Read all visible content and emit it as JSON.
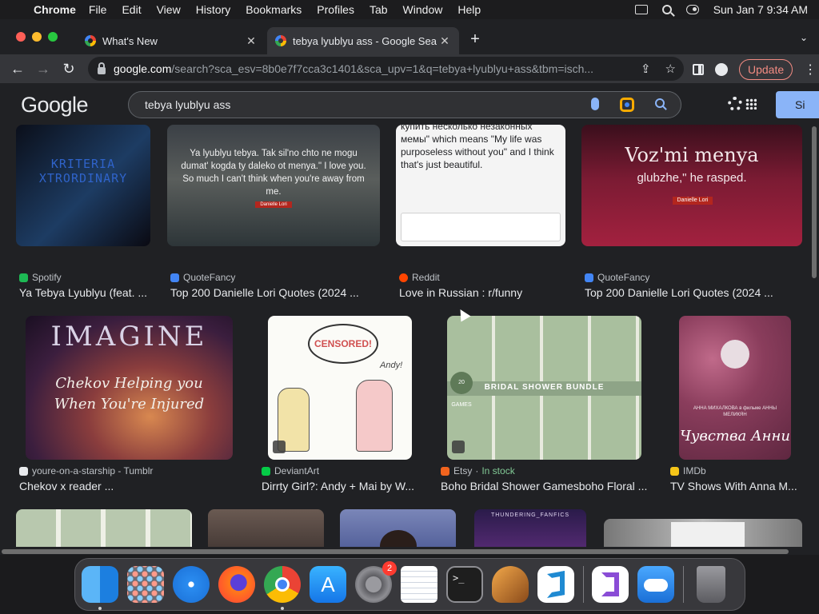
{
  "menubar": {
    "app": "Chrome",
    "items": [
      "File",
      "Edit",
      "View",
      "History",
      "Bookmarks",
      "Profiles",
      "Tab",
      "Window",
      "Help"
    ],
    "clock": "Sun Jan 7  9:34 AM"
  },
  "tabs": [
    {
      "title": "What's New",
      "close": "✕"
    },
    {
      "title": "tebya lyublyu ass - Google Sea",
      "close": "✕"
    }
  ],
  "toolbar": {
    "url_host": "google.com",
    "url_rest": "/search?sca_esv=8b0e7f7cca3c1401&sca_upv=1&q=tebya+lyublyu+ass&tbm=isch...",
    "update_label": "Update"
  },
  "google": {
    "logo": "Google",
    "query": "tebya lyublyu ass",
    "signin_label": "Si"
  },
  "results": [
    {
      "source": "Spotify",
      "title": "Ya Tebya Lyublyu (feat. ...",
      "icon_color": "#1db954",
      "thumb_text": "KRITERIA XTRORDINARY"
    },
    {
      "source": "QuoteFancy",
      "title": "Top 200 Danielle Lori Quotes (2024 ...",
      "icon_color": "#4285f4",
      "thumb_text": "Ya lyublyu tebya. Tak sil'no chto ne mogu dumat' kogda ty daleko ot menya.\" I love you. So much I can't think when you're away from me.",
      "thumb_sub": "Danielle Lori"
    },
    {
      "source": "Reddit",
      "title": "Love in Russian : r/funny",
      "icon_color": "#ff4500",
      "thumb_text": "купить несколько незаконных мемы\" which means \"My life was purposeless without you\" and I think that's just beautiful."
    },
    {
      "source": "QuoteFancy",
      "title": "Top 200 Danielle Lori Quotes (2024 ...",
      "icon_color": "#4285f4",
      "thumb_text": "Voz'mi menya",
      "thumb_sub2": "glubzhe,\" he rasped.",
      "thumb_sub": "Danielle Lori"
    },
    {
      "source": "youre-on-a-starship - Tumblr",
      "title": "Chekov x reader ...",
      "icon_color": "#e8eaed",
      "thumb_text": "IMAGINE",
      "thumb_sub": "Chekov Helping you When You're Injured"
    },
    {
      "source": "DeviantArt",
      "title": "Dirrty Girl?: Andy + Mai by W...",
      "icon_color": "#05cc47",
      "thumb_text": "CENSORED!",
      "thumb_sub": "Andy!"
    },
    {
      "source": "Etsy",
      "stock": "In stock",
      "title": "Boho Bridal Shower Gamesboho Floral ...",
      "icon_color": "#f1641e",
      "thumb_text": "BRIDAL SHOWER BUNDLE",
      "thumb_sub": "20 GAMES"
    },
    {
      "source": "IMDb",
      "title": "TV Shows With Anna M...",
      "icon_color": "#f5c518",
      "thumb_text": "Чувства Анни",
      "thumb_sub": "АННА МИХАЛКОВА в фильме АННЫ МЕЛИКЯН"
    },
    {
      "thumb_text": "",
      "title": ""
    },
    {
      "thumb_text": "",
      "title": ""
    },
    {
      "thumb_text": "",
      "title": ""
    },
    {
      "thumb_text": "THUNDERING_FANFICS",
      "title": ""
    },
    {
      "thumb_text": "",
      "title": ""
    }
  ],
  "dock": {
    "settings_badge": "2"
  }
}
